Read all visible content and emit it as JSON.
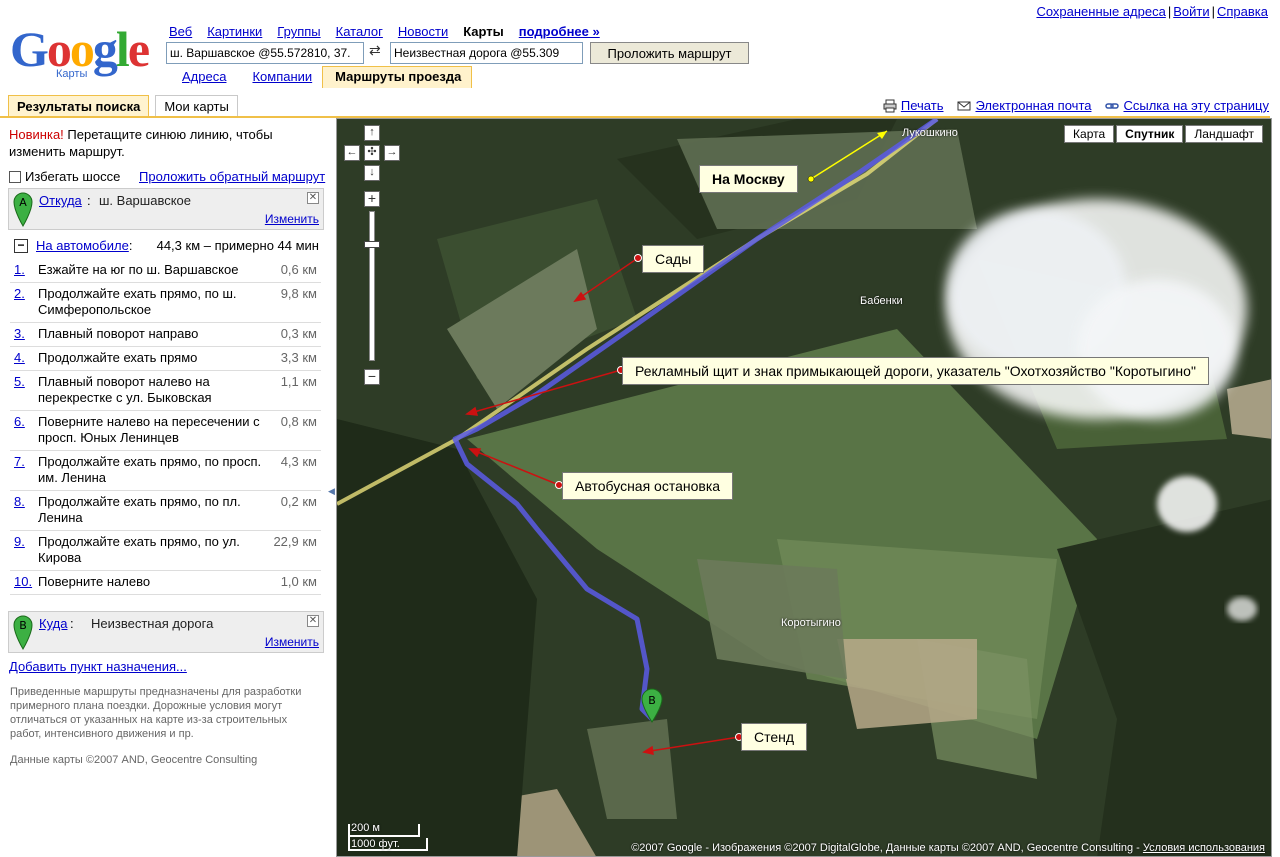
{
  "header": {
    "logo_text": "Google",
    "logo_sub": "Карты",
    "nav": [
      "Веб",
      "Картинки",
      "Группы",
      "Каталог",
      "Новости"
    ],
    "nav_current": "Карты",
    "nav_more": "подробнее »",
    "top_links": [
      "Сохраненные адреса",
      "Войти",
      "Справка"
    ],
    "from_value": "ш. Варшавское @55.572810, 37.",
    "to_value": "Неизвестная дорога @55.309",
    "route_button": "Проложить маршрут",
    "subtabs": [
      "Адреса",
      "Компании",
      "Маршруты проезда"
    ]
  },
  "results_tabs": [
    "Результаты поиска",
    "Мои карты"
  ],
  "actions": {
    "print": "Печать",
    "email": "Электронная почта",
    "link": "Ссылка на эту страницу"
  },
  "left": {
    "promo_new": "Новинка!",
    "promo_text": " Перетащите синюю линию, чтобы изменить маршрут.",
    "avoid_highways": "Избегать шоссе",
    "reverse_route": "Проложить обратный маршрут",
    "from": {
      "pin": "A",
      "label": "Откуда",
      "value": "ш. Варшавское",
      "edit": "Изменить"
    },
    "drive": {
      "label": "На автомобиле",
      "summary": "44,3 км – примерно 44 мин"
    },
    "steps": [
      {
        "num": "1.",
        "text": "Езжайте на юг по ш. Варшавское",
        "dist": "0,6 км"
      },
      {
        "num": "2.",
        "text": "Продолжайте ехать прямо, по ш. Симферопольское",
        "dist": "9,8 км"
      },
      {
        "num": "3.",
        "text": "Плавный поворот направо",
        "dist": "0,3 км"
      },
      {
        "num": "4.",
        "text": "Продолжайте ехать прямо",
        "dist": "3,3 км"
      },
      {
        "num": "5.",
        "text": "Плавный поворот налево на перекрестке с ул. Быковская",
        "dist": "1,1 км"
      },
      {
        "num": "6.",
        "text": "Поверните налево на пересечении с просп. Юных Ленинцев",
        "dist": "0,8 км"
      },
      {
        "num": "7.",
        "text": "Продолжайте ехать прямо, по просп. им. Ленина",
        "dist": "4,3 км"
      },
      {
        "num": "8.",
        "text": "Продолжайте ехать прямо, по пл. Ленина",
        "dist": "0,2 км"
      },
      {
        "num": "9.",
        "text": "Продолжайте ехать прямо, по ул. Кирова",
        "dist": "22,9 км"
      },
      {
        "num": "10.",
        "text": "Поверните налево",
        "dist": "1,0 км"
      }
    ],
    "to": {
      "pin": "B",
      "label": "Куда",
      "value": "Неизвестная дорога",
      "edit": "Изменить"
    },
    "add_destination": "Добавить пункт назначения...",
    "disclaimer": "Приведенные маршруты предназначены для разработки примерного плана поездки. Дорожные условия могут отличаться от указанных на карте из-за строительных работ, интенсивного движения и пр.",
    "map_data": "Данные карты ©2007 AND, Geocentre Consulting"
  },
  "map": {
    "types": [
      "Карта",
      "Спутник",
      "Ландшафт"
    ],
    "active_type": "Спутник",
    "places": [
      "Лукошкино",
      "Бабенки",
      "Коротыгино"
    ],
    "callouts": {
      "moscow": "На Москву",
      "gardens": "Сады",
      "billboard": "Рекламный щит и знак примыкающей дороги, указатель \"Охотхозяйство \"Коротыгино\"",
      "bus_stop": "Автобусная остановка",
      "stand": "Стенд"
    },
    "scale_m": "200 м",
    "scale_ft": "1000 фут.",
    "copyright": "©2007 Google - Изображения ©2007 DigitalGlobe, Данные карты ©2007 AND, Geocentre Consulting - ",
    "terms": "Условия использования",
    "colors": {
      "route": "#5a5ae6",
      "highway": "#e8e07a",
      "arrow": "#cc1111"
    }
  }
}
